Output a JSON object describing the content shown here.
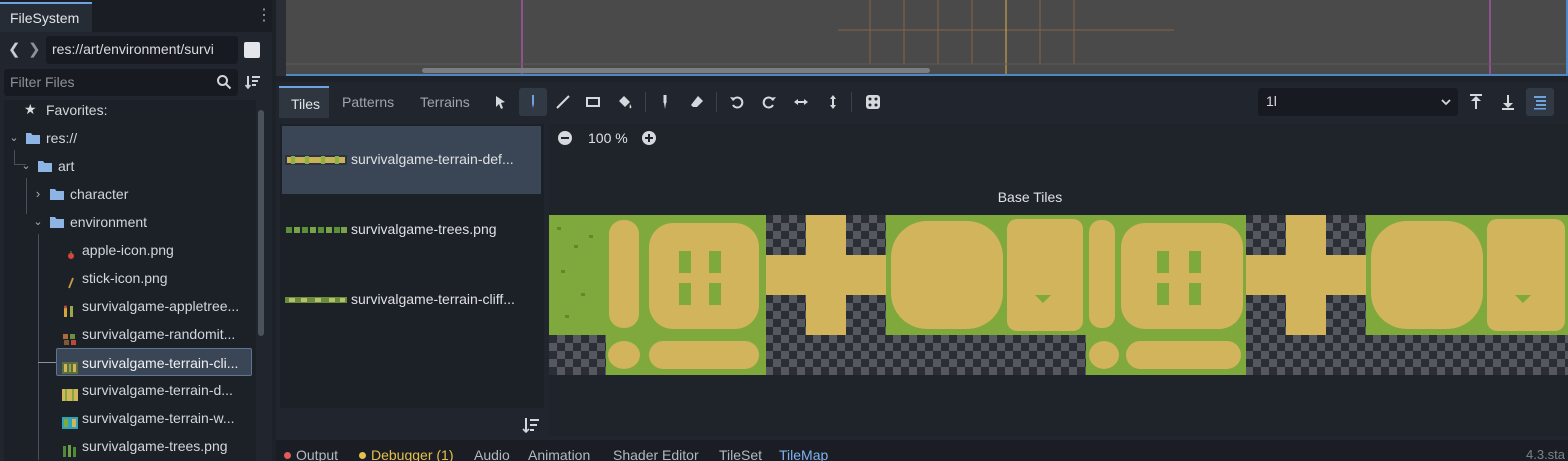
{
  "filesystem": {
    "tab_label": "FileSystem",
    "path": "res://art/environment/survi",
    "filter_placeholder": "Filter Files",
    "tree": {
      "favorites": "Favorites:",
      "root": "res://",
      "art": "art",
      "character": "character",
      "environment": "environment",
      "files": [
        {
          "name": "apple-icon.png",
          "icon": "apple-icon"
        },
        {
          "name": "stick-icon.png",
          "icon": "stick-icon"
        },
        {
          "name": "survivalgame-appletree...",
          "icon": "appletree-thumbnail-icon"
        },
        {
          "name": "survivalgame-randomit...",
          "icon": "randomitems-thumbnail-icon"
        },
        {
          "name": "survivalgame-terrain-cli...",
          "icon": "terrain-cliff-thumbnail-icon",
          "selected": true
        },
        {
          "name": "survivalgame-terrain-d...",
          "icon": "terrain-default-thumbnail-icon"
        },
        {
          "name": "survivalgame-terrain-w...",
          "icon": "terrain-water-thumbnail-icon"
        },
        {
          "name": "survivalgame-trees.png",
          "icon": "trees-thumbnail-icon"
        }
      ]
    }
  },
  "tilemap": {
    "tabs": [
      "Tiles",
      "Patterns",
      "Terrains"
    ],
    "active_tab": "Tiles",
    "layer_select": "1l",
    "atlas_sources": [
      {
        "label": "survivalgame-terrain-def...",
        "selected": true
      },
      {
        "label": "survivalgame-trees.png",
        "selected": false
      },
      {
        "label": "survivalgame-terrain-cliff...",
        "selected": false
      }
    ],
    "zoom": "100 %",
    "atlas_title": "Base Tiles"
  },
  "bottom_panel": {
    "tabs": [
      {
        "label": "Output",
        "dot": "#e05b5b"
      },
      {
        "label": "Debugger (1)",
        "dot": "#e6c04c"
      },
      {
        "label": "Audio"
      },
      {
        "label": "Animation"
      },
      {
        "label": "Shader Editor"
      },
      {
        "label": "TileSet"
      },
      {
        "label": "TileMap",
        "active": true
      }
    ],
    "version": "4.3.sta"
  },
  "colors": {
    "accent": "#6fa3e0",
    "grass": "#7fa83d",
    "sand": "#d1b45c",
    "selection": "#3a4555"
  }
}
